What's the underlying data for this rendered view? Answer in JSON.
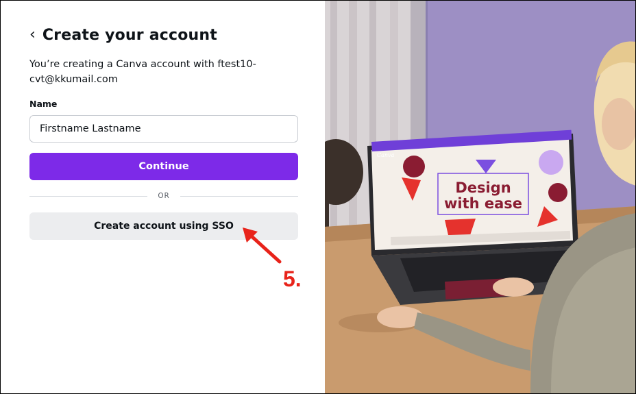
{
  "form": {
    "back_glyph": "‹",
    "title": "Create your account",
    "subtitle": "You’re creating a Canva account with ftest10-cvt@kkumail.com",
    "name_label": "Name",
    "name_value": "Firstname Lastname",
    "continue_label": "Continue",
    "divider_text": "OR",
    "sso_label": "Create account using SSO"
  },
  "annotation": {
    "step_label": "5.",
    "color": "#e8231a"
  },
  "promo": {
    "screen_logo": "Canva",
    "headline_line1": "Design",
    "headline_line2": "with ease"
  },
  "colors": {
    "accent": "#7d2ae8",
    "secondary_button": "#ecedef"
  }
}
